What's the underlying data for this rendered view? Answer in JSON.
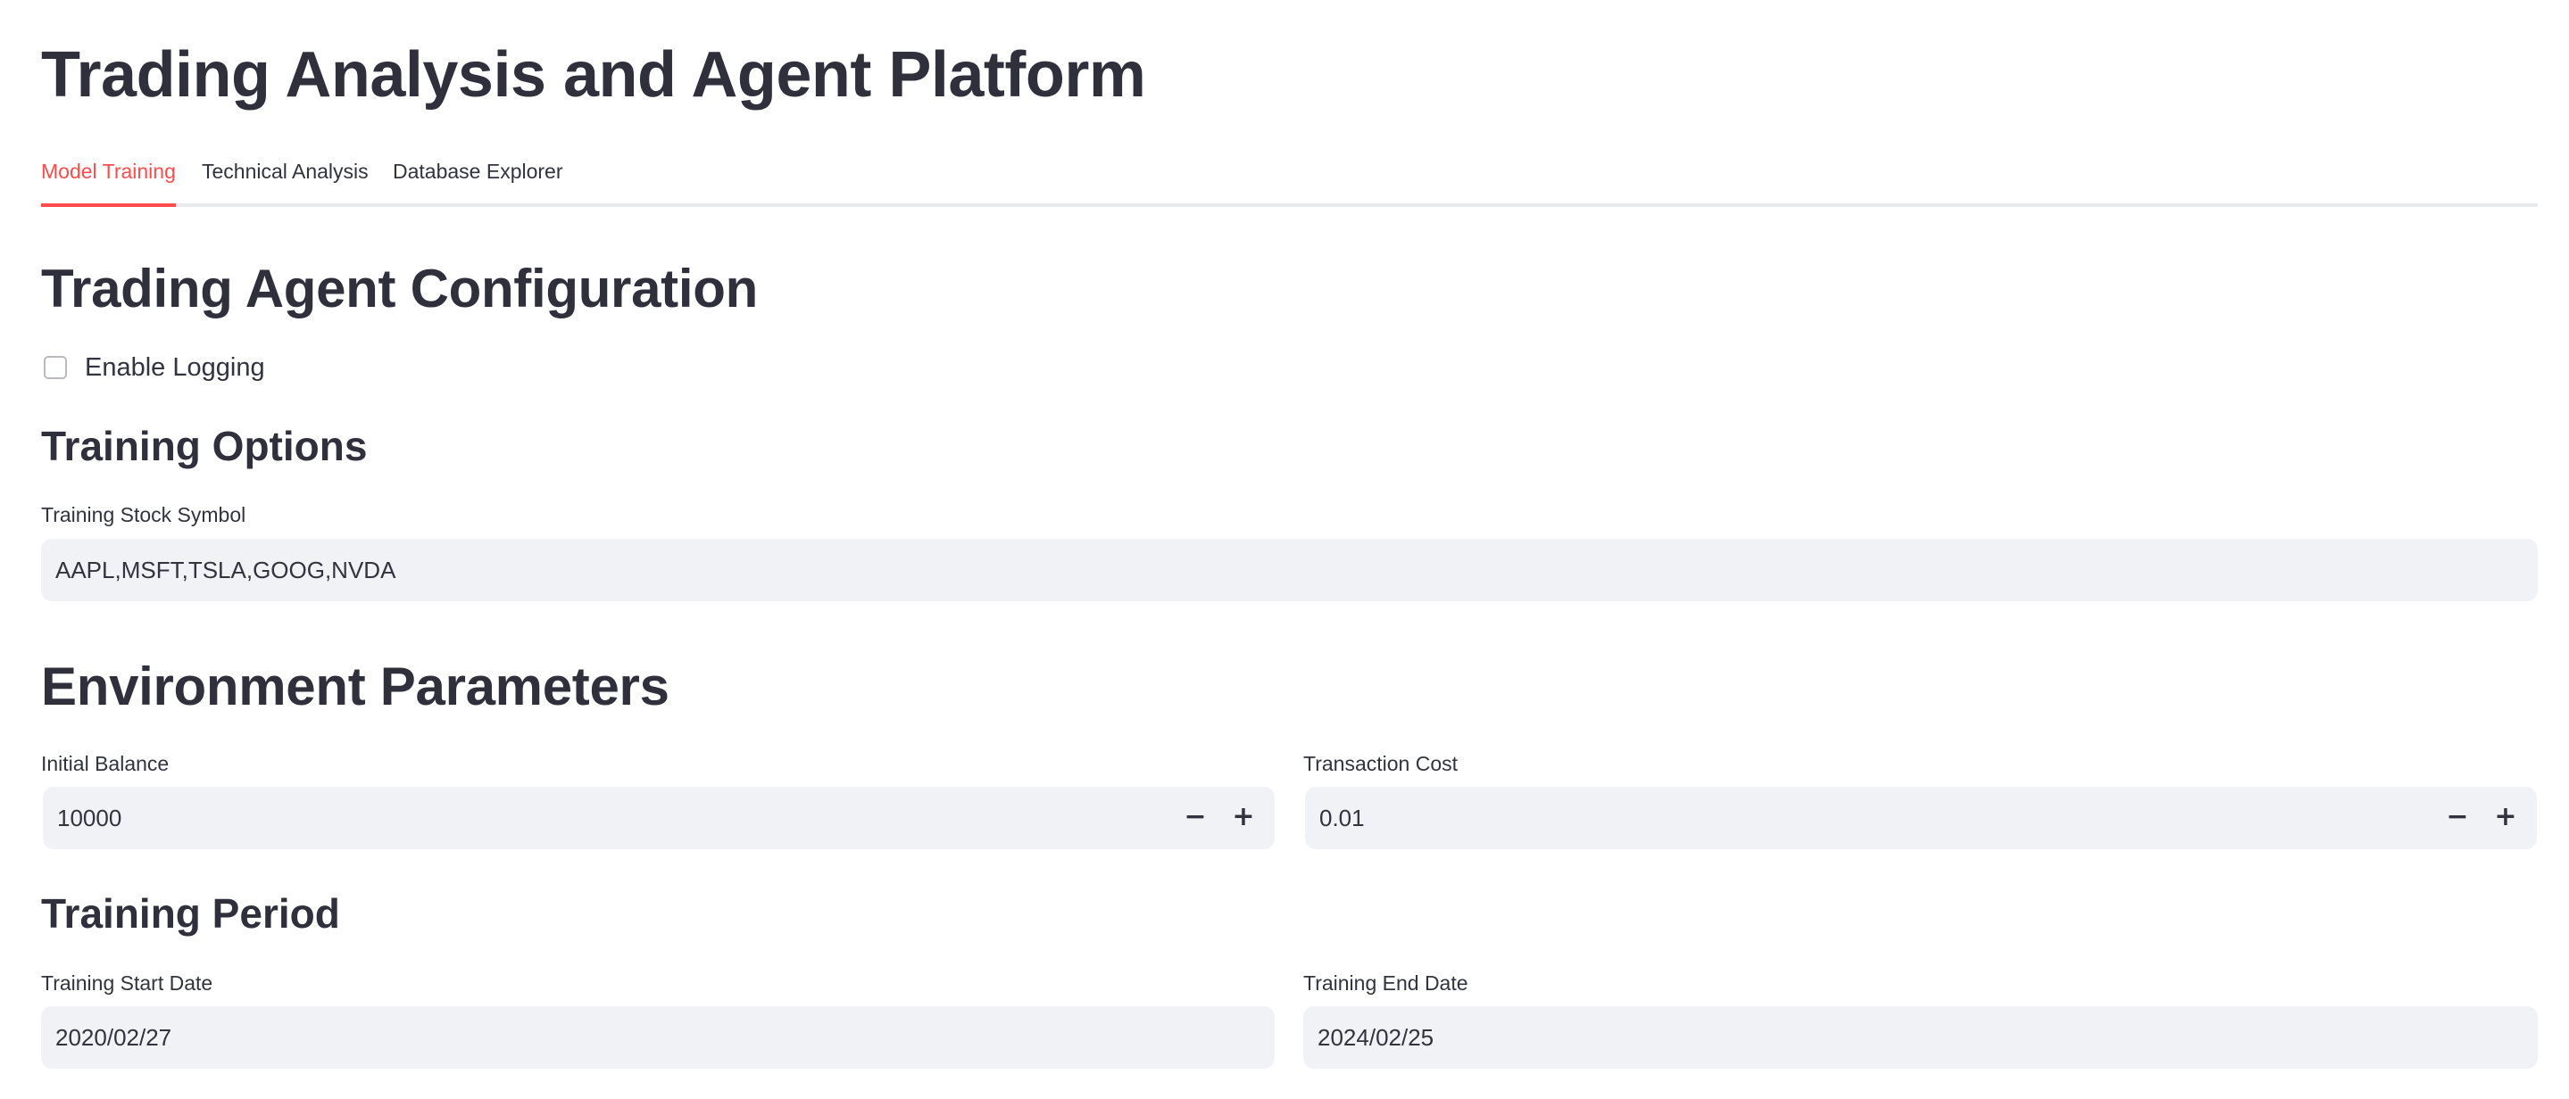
{
  "app": {
    "title": "Trading Analysis and Agent Platform"
  },
  "tabs": [
    {
      "label": "Model Training",
      "active": true
    },
    {
      "label": "Technical Analysis",
      "active": false
    },
    {
      "label": "Database Explorer",
      "active": false
    }
  ],
  "config": {
    "heading": "Trading Agent Configuration",
    "logging": {
      "label": "Enable Logging",
      "checked": false
    }
  },
  "training_options": {
    "heading": "Training Options",
    "symbol": {
      "label": "Training Stock Symbol",
      "value": "AAPL,MSFT,TSLA,GOOG,NVDA"
    }
  },
  "environment": {
    "heading": "Environment Parameters",
    "initial_balance": {
      "label": "Initial Balance",
      "value": "10000"
    },
    "transaction_cost": {
      "label": "Transaction Cost",
      "value": "0.01"
    },
    "minus_symbol": "−",
    "plus_symbol": "+"
  },
  "training_period": {
    "heading": "Training Period",
    "start": {
      "label": "Training Start Date",
      "value": "2020/02/27"
    },
    "end": {
      "label": "Training End Date",
      "value": "2024/02/25"
    }
  },
  "colors": {
    "accent": "#ff4b4b",
    "text": "#31333f",
    "input_bg": "#f0f2f6",
    "divider": "#e9eaee"
  }
}
